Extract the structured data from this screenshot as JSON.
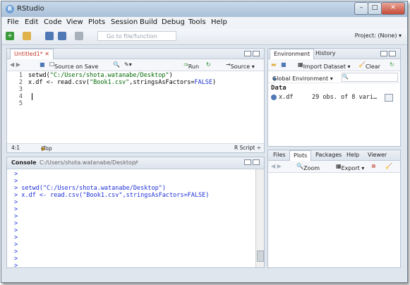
{
  "window": {
    "title": "RStudio",
    "min": "–",
    "max": "□",
    "close": "✕"
  },
  "menu": [
    "File",
    "Edit",
    "Code",
    "View",
    "Plots",
    "Session",
    "Build",
    "Debug",
    "Tools",
    "Help"
  ],
  "toolbar": {
    "goto_placeholder": "Go to file/function",
    "project": "Project: (None) ▾"
  },
  "editor": {
    "tab_label": "Untitled1*",
    "source_on_save": "Source on Save",
    "run_label": "Run",
    "source_label": "Source ▾",
    "lines": [
      {
        "n": "1",
        "text": "setwd(\"C:/Users/shota.watanabe/Desktop\")"
      },
      {
        "n": "2",
        "text": "x.df <- read.csv(\"Book1.csv\",stringsAsFactors=FALSE)"
      },
      {
        "n": "3",
        "text": ""
      },
      {
        "n": "4",
        "text": ""
      },
      {
        "n": "5",
        "text": ""
      }
    ],
    "status_pos": "4:1",
    "status_scope": "(Top Level) ÷",
    "status_type": "R Script ÷"
  },
  "console": {
    "label": "Console",
    "path": "C:/Users/shota.watanabe/Desktop/",
    "lines": [
      ">",
      ">",
      "> setwd(\"C:/Users/shota.watanabe/Desktop\")",
      "> x.df <- read.csv(\"Book1.csv\",stringsAsFactors=FALSE)",
      ">",
      ">",
      ">",
      ">",
      ">",
      ">",
      ">",
      ">",
      ">",
      ">",
      "> |"
    ]
  },
  "env": {
    "tabs": [
      "Environment",
      "History"
    ],
    "import_label": "Import Dataset ▾",
    "clear_label": "Clear",
    "global_env": "Global Environment ▾",
    "section": "Data",
    "var_name": "x.df",
    "var_desc": "29 obs. of 8 vari…"
  },
  "files": {
    "tabs": [
      "Files",
      "Plots",
      "Packages",
      "Help",
      "Viewer"
    ],
    "zoom_label": "Zoom",
    "export_label": "Export ▾"
  },
  "colors": {
    "accent": "#1c2fd6",
    "string": "#036a07",
    "titlebar": "#b9cde2"
  }
}
